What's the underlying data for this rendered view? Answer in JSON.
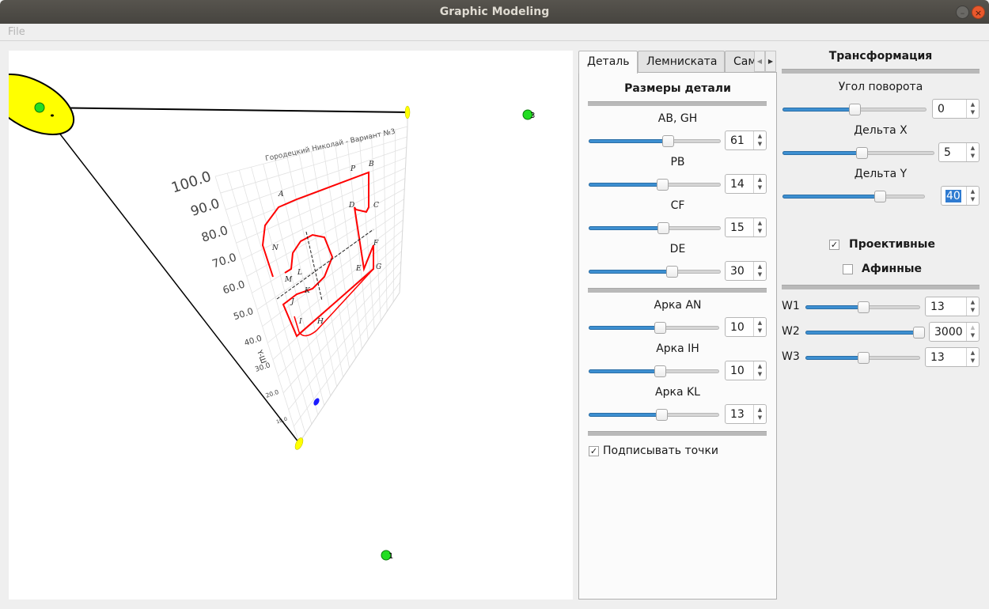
{
  "window": {
    "title": "Graphic Modeling",
    "minimize_icon": "minimize-icon",
    "close_icon": "close-icon",
    "min_glyph": "–",
    "close_glyph": "×"
  },
  "menu": {
    "items": [
      {
        "label": "File"
      }
    ]
  },
  "tabs": {
    "items": [
      {
        "label": "Деталь",
        "active": true
      },
      {
        "label": "Лемниската",
        "active": false
      },
      {
        "label": "Самолет",
        "active": false
      }
    ],
    "scroll_left_glyph": "◀",
    "scroll_right_glyph": "▶"
  },
  "detail_panel": {
    "heading": "Размеры детали",
    "sliders": [
      {
        "label": "AB, GH",
        "value": "61",
        "fraction": 0.61
      },
      {
        "label": "PB",
        "value": "14",
        "fraction": 0.56
      },
      {
        "label": "CF",
        "value": "15",
        "fraction": 0.57
      },
      {
        "label": "DE",
        "value": "30",
        "fraction": 0.64
      }
    ],
    "arc_sliders": [
      {
        "label": "Арка AN",
        "value": "10",
        "fraction": 0.55
      },
      {
        "label": "Арка IH",
        "value": "10",
        "fraction": 0.55
      },
      {
        "label": "Арка KL",
        "value": "13",
        "fraction": 0.56
      }
    ],
    "label_points": {
      "label": "Подписывать точки",
      "checked": true,
      "glyph": "✓"
    }
  },
  "transform_panel": {
    "heading": "Трансформация",
    "sliders": [
      {
        "label": "Угол поворота",
        "value": "0",
        "fraction": 0.5,
        "selected": false
      },
      {
        "label": "Дельта X",
        "value": "5",
        "fraction": 0.52,
        "selected": false
      },
      {
        "label": "Дельта  Y",
        "value": "40",
        "fraction": 0.7,
        "selected": true
      }
    ],
    "projective": {
      "label": "Проективные",
      "checked": true,
      "glyph": "✓"
    },
    "affine": {
      "label": "Афинные",
      "checked": false,
      "glyph": ""
    },
    "weights": [
      {
        "label": "W1",
        "value": "13",
        "fraction": 0.5
      },
      {
        "label": "W2",
        "value": "3000",
        "fraction": 1.0
      },
      {
        "label": "W3",
        "value": "13",
        "fraction": 0.5
      }
    ]
  },
  "canvas": {
    "chart_title": "Городецкий Николай - Вариант №3",
    "y_ticks": [
      "100.0",
      "90.0",
      "80.0",
      "70.0",
      "60.0",
      "50.0",
      "40.0",
      "30.0",
      "20.0",
      "10.0"
    ],
    "y_axis_label": "Y-Ш",
    "point_labels": [
      "A",
      "B",
      "C",
      "D",
      "E",
      "F",
      "G",
      "H",
      "I",
      "J",
      "K",
      "L",
      "M",
      "N",
      "P"
    ],
    "control_points": [
      "1",
      "3"
    ],
    "colors": {
      "contour": "#ff0000",
      "control_point": "#22dd22",
      "weight_ellipse": "#ffff00",
      "origin": "#1a1aff"
    }
  }
}
